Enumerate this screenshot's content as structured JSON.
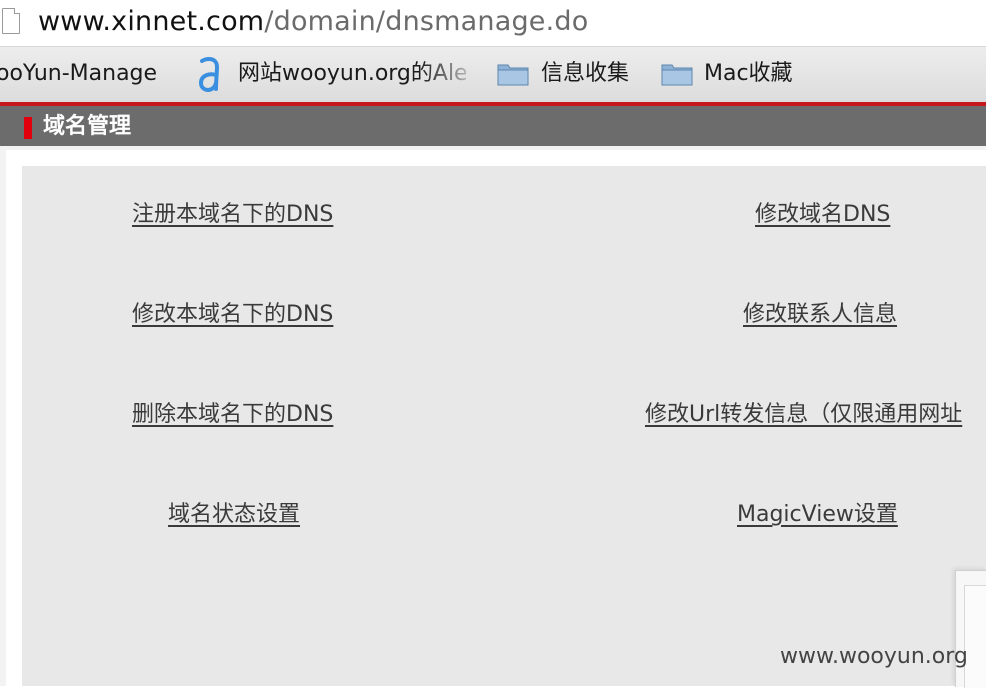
{
  "browser": {
    "url_host": "www.xinnet.com",
    "url_path": "/domain/dnsmanage.do"
  },
  "bookmarks": {
    "items": [
      {
        "label": "ooYun-Manage"
      },
      {
        "label": "网站wooyun.org的Ale",
        "icon": "alexa-icon"
      },
      {
        "label": "信息收集",
        "icon": "folder-icon"
      },
      {
        "label": "Mac收藏",
        "icon": "folder-icon"
      }
    ]
  },
  "page": {
    "title": "域名管理",
    "accent_color": "#e1000b",
    "links_left": [
      "注册本域名下的DNS",
      "修改本域名下的DNS",
      "删除本域名下的DNS",
      "域名状态设置"
    ],
    "links_right": [
      "修改域名DNS",
      "修改联系人信息",
      "修改Url转发信息（仅限通用网址",
      "MagicView设置"
    ]
  },
  "watermark": "www.wooyun.org"
}
